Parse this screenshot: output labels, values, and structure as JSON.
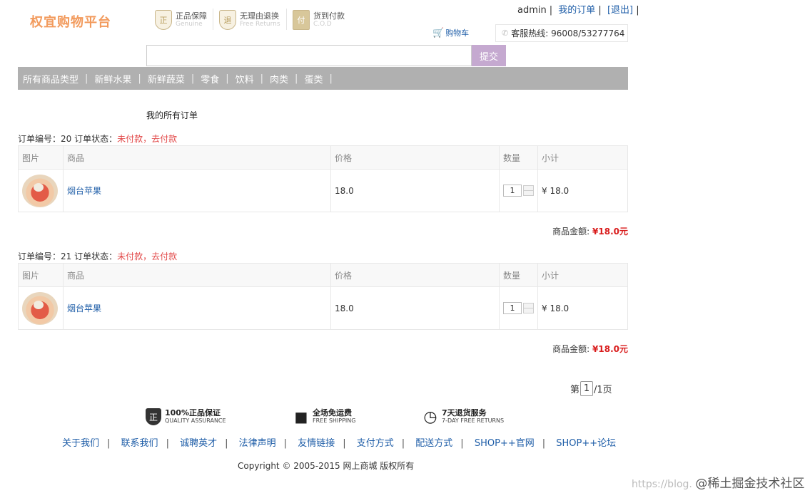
{
  "header": {
    "logo_text": "权宜购物平台",
    "badges": [
      {
        "icon": "shield-icon",
        "glyph": "正",
        "title": "正品保障",
        "subtitle": "Genuine"
      },
      {
        "icon": "return-icon",
        "glyph": "退",
        "title": "无理由退换",
        "subtitle": "Free Returns"
      },
      {
        "icon": "cod-icon",
        "glyph": "付",
        "title": "货到付款",
        "subtitle": "C.O.D"
      }
    ],
    "user": "admin",
    "sep": "|",
    "my_orders": "我的订单",
    "logout": "[退出]",
    "cart": "购物车",
    "hotline": "客服热线: 96008/53277764"
  },
  "search": {
    "value": "",
    "submit": "提交"
  },
  "nav": {
    "items": [
      "所有商品类型",
      "新鲜水果",
      "新鲜蔬菜",
      "零食",
      "饮料",
      "肉类",
      "蛋类"
    ],
    "sep": "|"
  },
  "page_title": "我的所有订单",
  "table_headers": [
    "图片",
    "商品",
    "价格",
    "数量",
    "小计"
  ],
  "orders": [
    {
      "number_label": "订单编号：20 订单状态：",
      "status": "未付款，去付款",
      "item": {
        "name": "烟台苹果",
        "price": "18.0",
        "qty": "1",
        "subtotal": "¥ 18.0"
      },
      "total_label": "商品金额:",
      "total": "¥18.0元"
    },
    {
      "number_label": "订单编号：21 订单状态：",
      "status": "未付款，去付款",
      "item": {
        "name": "烟台苹果",
        "price": "18.0",
        "qty": "1",
        "subtotal": "¥ 18.0"
      },
      "total_label": "商品金额:",
      "total": "¥18.0元"
    }
  ],
  "pager": {
    "prefix": "第",
    "current": "1",
    "suffix": "/1页"
  },
  "footer": {
    "badges": [
      {
        "icon": "shield-icon",
        "glyph": "正",
        "title": "100%正品保证",
        "subtitle": "QUALITY ASSURANCE"
      },
      {
        "icon": "box-icon",
        "glyph": "■",
        "title": "全场免运费",
        "subtitle": "FREE SHIPPING"
      },
      {
        "icon": "clock-icon",
        "glyph": "◷",
        "title": "7天退货服务",
        "subtitle": "7-DAY FREE RETURNS"
      }
    ],
    "links": [
      "关于我们",
      "联系我们",
      "诚聘英才",
      "法律声明",
      "友情链接",
      "支付方式",
      "配送方式",
      "SHOP++官网",
      "SHOP++论坛"
    ],
    "link_sep": "|",
    "copyright": "Copyright © 2005-2015 网上商城 版权所有"
  },
  "watermark": {
    "url": "https://blog.",
    "brand": "@稀土掘金技术社区"
  }
}
